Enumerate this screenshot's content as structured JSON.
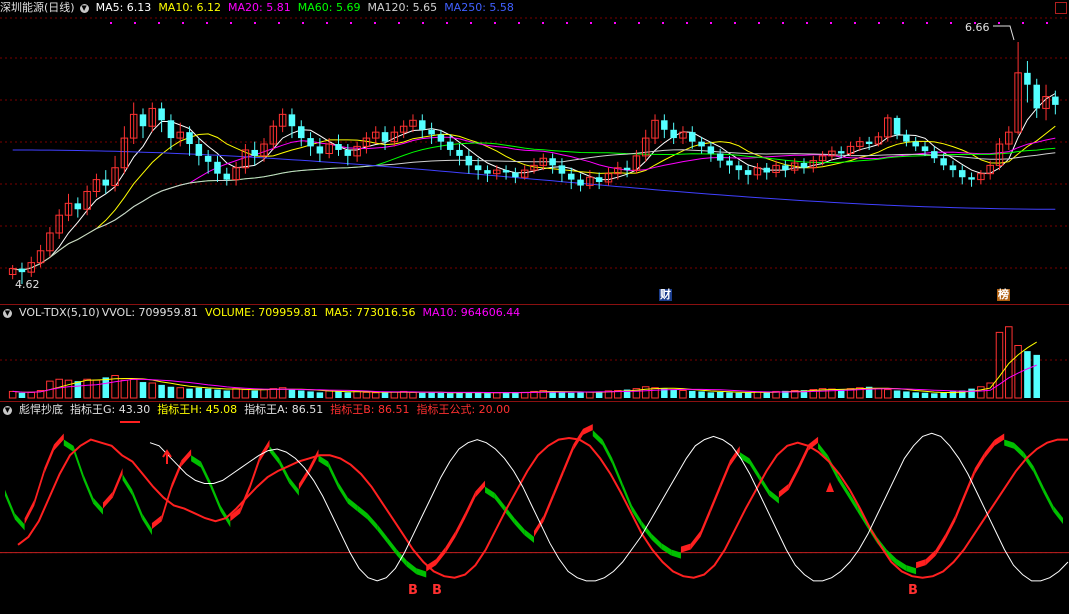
{
  "main": {
    "title": "深圳能源(日线)",
    "ma5": "MA5: 6.13",
    "ma10": "MA10: 6.12",
    "ma20": "MA20: 5.81",
    "ma60": "MA60: 5.69",
    "ma120": "MA120: 5.65",
    "ma250": "MA250: 5.58",
    "high_label": "6.66",
    "low_label": "4.62",
    "flag_cai": "财",
    "flag_bang": "榜"
  },
  "volume": {
    "title": "VOL-TDX(5,10)",
    "vvol": "VVOL: 709959.81",
    "volume": "VOLUME: 709959.81",
    "ma5": "MA5: 773016.56",
    "ma10": "MA10: 964606.44"
  },
  "indicator": {
    "title": "彪悍抄底",
    "g": "指标王G: 43.30",
    "h": "指标王H: 45.08",
    "a": "指标王A: 86.51",
    "b": "指标王B: 86.51",
    "formula": "指标王公式: 20.00",
    "signals": [
      "B",
      "B",
      "B"
    ]
  },
  "colors": {
    "up": "#ff3232",
    "down": "#54ffff",
    "ma5": "#ffffff",
    "ma10": "#ffff00",
    "ma20": "#ff00ff",
    "ma60": "#00ff00",
    "ma120": "#d0d0d0",
    "ma250": "#4040ff",
    "grid": "#7a0000"
  },
  "chart_data": [
    {
      "type": "candlestick",
      "price_range": [
        4.62,
        6.66
      ],
      "high": 6.66,
      "low": 4.62,
      "candles": [
        [
          4.7,
          4.75,
          4.66,
          4.78
        ],
        [
          4.75,
          4.72,
          4.62,
          4.8
        ],
        [
          4.72,
          4.8,
          4.68,
          4.85
        ],
        [
          4.8,
          4.9,
          4.76,
          4.95
        ],
        [
          4.9,
          5.05,
          4.85,
          5.1
        ],
        [
          5.05,
          5.2,
          5.0,
          5.25
        ],
        [
          5.2,
          5.3,
          5.15,
          5.38
        ],
        [
          5.3,
          5.25,
          5.18,
          5.35
        ],
        [
          5.25,
          5.4,
          5.2,
          5.45
        ],
        [
          5.4,
          5.5,
          5.35,
          5.55
        ],
        [
          5.5,
          5.45,
          5.38,
          5.58
        ],
        [
          5.45,
          5.6,
          5.4,
          5.7
        ],
        [
          5.6,
          5.85,
          5.55,
          5.95
        ],
        [
          5.85,
          6.05,
          5.8,
          6.15
        ],
        [
          6.05,
          5.95,
          5.85,
          6.1
        ],
        [
          5.95,
          6.1,
          5.9,
          6.15
        ],
        [
          6.1,
          6.0,
          5.9,
          6.15
        ],
        [
          6.0,
          5.85,
          5.75,
          6.05
        ],
        [
          5.85,
          5.9,
          5.78,
          5.98
        ],
        [
          5.9,
          5.8,
          5.7,
          5.95
        ],
        [
          5.8,
          5.7,
          5.62,
          5.85
        ],
        [
          5.7,
          5.65,
          5.55,
          5.75
        ],
        [
          5.65,
          5.55,
          5.48,
          5.7
        ],
        [
          5.55,
          5.5,
          5.45,
          5.6
        ],
        [
          5.5,
          5.6,
          5.45,
          5.65
        ],
        [
          5.6,
          5.75,
          5.55,
          5.8
        ],
        [
          5.75,
          5.7,
          5.62,
          5.82
        ],
        [
          5.7,
          5.8,
          5.65,
          5.85
        ],
        [
          5.8,
          5.95,
          5.75,
          6.0
        ],
        [
          5.95,
          6.05,
          5.9,
          6.1
        ],
        [
          6.05,
          5.95,
          5.85,
          6.1
        ],
        [
          5.95,
          5.85,
          5.78,
          6.0
        ],
        [
          5.85,
          5.78,
          5.7,
          5.9
        ],
        [
          5.78,
          5.72,
          5.65,
          5.85
        ],
        [
          5.72,
          5.8,
          5.68,
          5.85
        ],
        [
          5.8,
          5.75,
          5.7,
          5.88
        ],
        [
          5.75,
          5.7,
          5.62,
          5.8
        ],
        [
          5.7,
          5.78,
          5.65,
          5.82
        ],
        [
          5.78,
          5.85,
          5.72,
          5.9
        ],
        [
          5.85,
          5.9,
          5.8,
          5.95
        ],
        [
          5.9,
          5.82,
          5.75,
          5.95
        ],
        [
          5.82,
          5.9,
          5.78,
          5.95
        ],
        [
          5.9,
          5.95,
          5.85,
          6.0
        ],
        [
          5.95,
          6.0,
          5.9,
          6.05
        ],
        [
          6.0,
          5.92,
          5.85,
          6.05
        ],
        [
          5.92,
          5.88,
          5.8,
          5.98
        ],
        [
          5.88,
          5.82,
          5.75,
          5.92
        ],
        [
          5.82,
          5.75,
          5.7,
          5.88
        ],
        [
          5.75,
          5.7,
          5.62,
          5.8
        ],
        [
          5.7,
          5.62,
          5.55,
          5.75
        ],
        [
          5.62,
          5.58,
          5.5,
          5.68
        ],
        [
          5.58,
          5.55,
          5.48,
          5.62
        ],
        [
          5.55,
          5.58,
          5.5,
          5.62
        ],
        [
          5.58,
          5.56,
          5.5,
          5.62
        ],
        [
          5.56,
          5.52,
          5.47,
          5.6
        ],
        [
          5.52,
          5.58,
          5.5,
          5.62
        ],
        [
          5.58,
          5.62,
          5.55,
          5.68
        ],
        [
          5.62,
          5.68,
          5.58,
          5.72
        ],
        [
          5.68,
          5.62,
          5.55,
          5.72
        ],
        [
          5.62,
          5.55,
          5.48,
          5.68
        ],
        [
          5.55,
          5.5,
          5.42,
          5.6
        ],
        [
          5.5,
          5.45,
          5.4,
          5.55
        ],
        [
          5.45,
          5.52,
          5.42,
          5.58
        ],
        [
          5.52,
          5.48,
          5.42,
          5.56
        ],
        [
          5.48,
          5.55,
          5.45,
          5.6
        ],
        [
          5.55,
          5.6,
          5.5,
          5.65
        ],
        [
          5.6,
          5.58,
          5.52,
          5.66
        ],
        [
          5.58,
          5.7,
          5.55,
          5.75
        ],
        [
          5.7,
          5.85,
          5.65,
          5.92
        ],
        [
          5.85,
          6.0,
          5.8,
          6.05
        ],
        [
          6.0,
          5.92,
          5.85,
          6.05
        ],
        [
          5.92,
          5.85,
          5.8,
          5.98
        ],
        [
          5.85,
          5.9,
          5.8,
          5.95
        ],
        [
          5.9,
          5.82,
          5.76,
          5.95
        ],
        [
          5.82,
          5.78,
          5.72,
          5.86
        ],
        [
          5.78,
          5.72,
          5.65,
          5.82
        ],
        [
          5.72,
          5.66,
          5.6,
          5.76
        ],
        [
          5.66,
          5.62,
          5.55,
          5.7
        ],
        [
          5.62,
          5.58,
          5.5,
          5.66
        ],
        [
          5.58,
          5.54,
          5.46,
          5.62
        ],
        [
          5.54,
          5.6,
          5.5,
          5.64
        ],
        [
          5.6,
          5.56,
          5.5,
          5.64
        ],
        [
          5.56,
          5.62,
          5.52,
          5.66
        ],
        [
          5.62,
          5.58,
          5.52,
          5.66
        ],
        [
          5.58,
          5.64,
          5.55,
          5.68
        ],
        [
          5.64,
          5.6,
          5.55,
          5.68
        ],
        [
          5.6,
          5.66,
          5.56,
          5.7
        ],
        [
          5.66,
          5.7,
          5.62,
          5.74
        ],
        [
          5.7,
          5.74,
          5.66,
          5.78
        ],
        [
          5.74,
          5.72,
          5.68,
          5.78
        ],
        [
          5.72,
          5.78,
          5.7,
          5.82
        ],
        [
          5.78,
          5.82,
          5.74,
          5.86
        ],
        [
          5.82,
          5.8,
          5.75,
          5.86
        ],
        [
          5.8,
          5.86,
          5.78,
          5.9
        ],
        [
          5.86,
          6.02,
          5.82,
          6.05
        ],
        [
          6.02,
          5.88,
          5.84,
          6.04
        ],
        [
          5.88,
          5.82,
          5.78,
          5.92
        ],
        [
          5.82,
          5.78,
          5.74,
          5.86
        ],
        [
          5.78,
          5.74,
          5.7,
          5.82
        ],
        [
          5.74,
          5.68,
          5.64,
          5.78
        ],
        [
          5.68,
          5.62,
          5.58,
          5.72
        ],
        [
          5.62,
          5.58,
          5.52,
          5.66
        ],
        [
          5.58,
          5.52,
          5.46,
          5.62
        ],
        [
          5.52,
          5.5,
          5.44,
          5.56
        ],
        [
          5.5,
          5.55,
          5.46,
          5.58
        ],
        [
          5.55,
          5.62,
          5.5,
          5.66
        ],
        [
          5.62,
          5.8,
          5.58,
          5.85
        ],
        [
          5.8,
          5.9,
          5.75,
          5.95
        ],
        [
          5.9,
          6.4,
          5.88,
          6.66
        ],
        [
          6.4,
          6.3,
          6.15,
          6.5
        ],
        [
          6.3,
          6.1,
          6.02,
          6.35
        ],
        [
          6.1,
          6.2,
          6.0,
          6.3
        ],
        [
          6.2,
          6.13,
          6.05,
          6.25
        ]
      ]
    },
    {
      "type": "bar",
      "series": [
        {
          "name": "VOLUME",
          "values": [
            0.35,
            0.28,
            0.3,
            0.4,
            0.9,
            1.0,
            0.95,
            0.9,
            1.0,
            0.95,
            1.1,
            1.2,
            0.95,
            1.0,
            0.85,
            0.8,
            0.7,
            0.6,
            0.55,
            0.5,
            0.55,
            0.5,
            0.45,
            0.4,
            0.5,
            0.45,
            0.4,
            0.45,
            0.5,
            0.55,
            0.45,
            0.4,
            0.35,
            0.3,
            0.38,
            0.35,
            0.3,
            0.35,
            0.3,
            0.28,
            0.3,
            0.32,
            0.35,
            0.3,
            0.28,
            0.3,
            0.28,
            0.26,
            0.3,
            0.32,
            0.28,
            0.26,
            0.28,
            0.3,
            0.32,
            0.3,
            0.35,
            0.4,
            0.35,
            0.3,
            0.28,
            0.3,
            0.32,
            0.35,
            0.38,
            0.4,
            0.45,
            0.5,
            0.6,
            0.55,
            0.5,
            0.45,
            0.4,
            0.38,
            0.35,
            0.3,
            0.32,
            0.3,
            0.28,
            0.3,
            0.32,
            0.3,
            0.35,
            0.38,
            0.4,
            0.42,
            0.45,
            0.5,
            0.48,
            0.45,
            0.5,
            0.55,
            0.6,
            0.5,
            0.45,
            0.4,
            0.35,
            0.3,
            0.28,
            0.25,
            0.3,
            0.35,
            0.4,
            0.5,
            0.6,
            0.8,
            3.5,
            3.8,
            2.8,
            2.5,
            2.3
          ]
        }
      ]
    },
    {
      "type": "line",
      "reference_level": 20.0,
      "series": [
        {
          "name": "指标王G",
          "values": [
            60,
            45,
            38,
            50,
            70,
            85,
            92,
            88,
            70,
            55,
            48,
            55,
            70,
            60,
            45,
            35,
            40,
            60,
            75,
            82,
            78,
            65,
            50,
            40,
            45,
            60,
            78,
            88,
            80,
            68,
            60,
            70,
            82,
            78,
            65,
            55,
            50,
            45,
            38,
            30,
            22,
            15,
            10,
            8,
            12,
            20,
            30,
            42,
            55,
            62,
            58,
            50,
            42,
            35,
            30,
            40,
            55,
            70,
            85,
            95,
            98,
            92,
            80,
            65,
            50,
            40,
            32,
            26,
            22,
            20,
            22,
            30,
            45,
            60,
            75,
            84,
            80,
            70,
            60,
            55,
            60,
            72,
            85,
            90,
            82,
            70,
            60,
            50,
            40,
            30,
            22,
            16,
            12,
            10,
            12,
            18,
            28,
            40,
            55,
            70,
            80,
            88,
            92,
            90,
            84,
            75,
            62,
            50,
            42
          ]
        },
        {
          "name": "指标王B",
          "values": [
            25,
            30,
            40,
            55,
            70,
            82,
            88,
            92,
            90,
            88,
            82,
            78,
            70,
            62,
            55,
            50,
            48,
            45,
            42,
            40,
            42,
            48,
            55,
            62,
            68,
            72,
            75,
            78,
            80,
            82,
            82,
            80,
            76,
            70,
            62,
            52,
            42,
            32,
            22,
            14,
            8,
            5,
            4,
            6,
            12,
            22,
            35,
            48,
            60,
            72,
            82,
            88,
            92,
            93,
            92,
            88,
            80,
            70,
            58,
            45,
            32,
            22,
            14,
            8,
            5,
            4,
            6,
            12,
            22,
            35,
            48,
            60,
            72,
            82,
            88,
            90,
            88,
            84,
            78,
            70,
            60,
            48,
            35,
            24,
            14,
            8,
            5,
            4,
            5,
            8,
            14,
            22,
            32,
            42,
            52,
            62,
            72,
            80,
            86,
            90,
            92,
            92
          ]
        },
        {
          "name": "白线",
          "values": [
            90,
            88,
            82,
            76,
            70,
            66,
            64,
            64,
            66,
            70,
            74,
            78,
            82,
            85,
            86,
            84,
            80,
            74,
            66,
            56,
            44,
            32,
            20,
            10,
            4,
            2,
            4,
            10,
            20,
            32,
            44,
            56,
            68,
            78,
            86,
            90,
            92,
            90,
            86,
            80,
            72,
            62,
            50,
            38,
            26,
            16,
            8,
            4,
            2,
            2,
            4,
            8,
            14,
            22,
            30,
            40,
            50,
            60,
            70,
            80,
            88,
            92,
            94,
            92,
            88,
            80,
            70,
            58,
            46,
            34,
            22,
            12,
            6,
            2,
            2,
            4,
            8,
            14,
            22,
            32,
            44,
            56,
            68,
            80,
            88,
            94,
            96,
            94,
            88,
            80,
            70,
            58,
            46,
            34,
            22,
            12,
            6,
            2,
            2,
            4,
            8,
            14
          ]
        }
      ]
    }
  ]
}
